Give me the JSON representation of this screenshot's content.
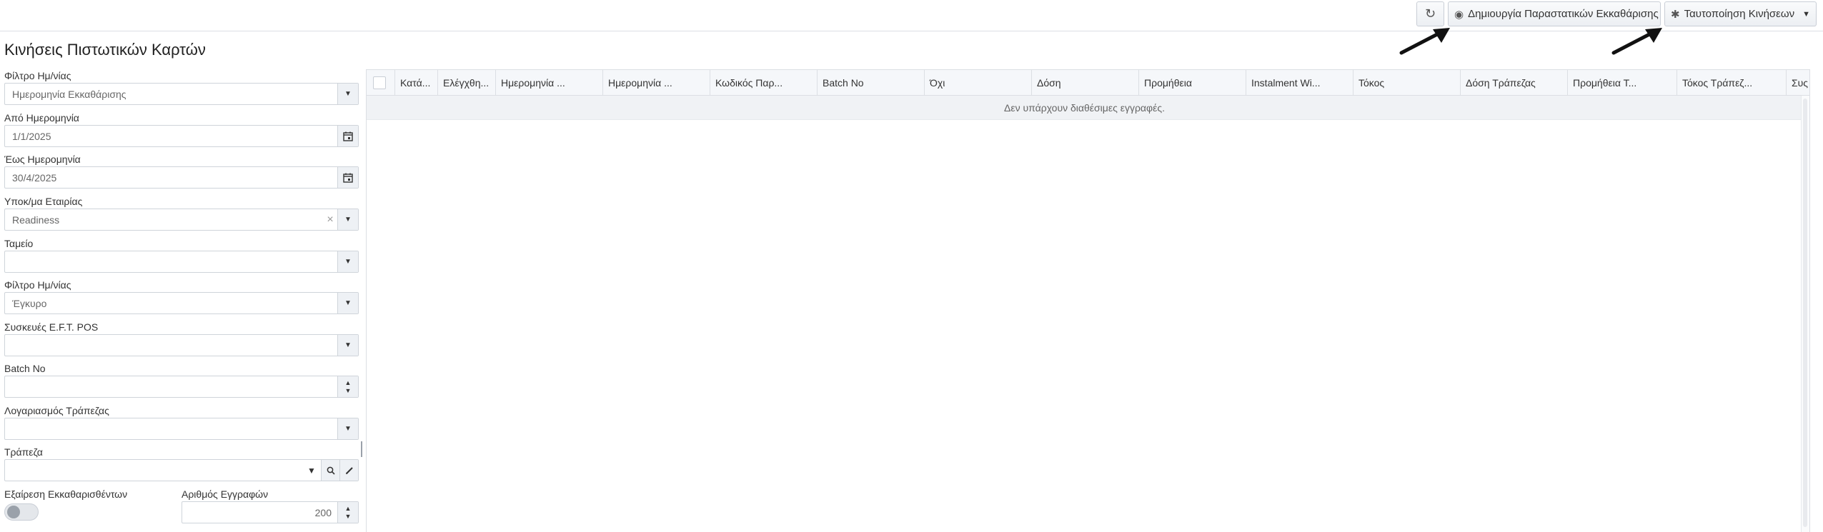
{
  "toolbar": {
    "refresh_icon": "refresh-icon",
    "create_label": "Δημιουργία Παραστατικών Εκκαθάρισης",
    "match_label": "Ταυτοποίηση Κινήσεων"
  },
  "page": {
    "title": "Κινήσεις Πιστωτικών Καρτών"
  },
  "form": {
    "date_filter_label": "Φίλτρο Ημ/νίας",
    "date_filter_value": "Ημερομηνία Εκκαθάρισης",
    "from_date_label": "Από Ημερομηνία",
    "from_date_value": "1/1/2025",
    "to_date_label": "Έως Ημερομηνία",
    "to_date_value": "30/4/2025",
    "branch_label": "Υποκ/μα Εταιρίας",
    "branch_value": "Readiness",
    "cashier_label": "Ταμείο",
    "cashier_value": "",
    "date_filter2_label": "Φίλτρο Ημ/νίας",
    "date_filter2_value": "Έγκυρο",
    "eft_label": "Συσκευές E.F.T. POS",
    "eft_value": "",
    "batch_label": "Batch No",
    "batch_value": "",
    "bank_account_label": "Λογαριασμός Τράπεζας",
    "bank_account_value": "",
    "bank_label": "Τράπεζα",
    "bank_value": "",
    "exclude_label": "Εξαίρεση Εκκαθαρισθέντων",
    "records_label": "Αριθμός Εγγραφών",
    "records_value": "200"
  },
  "grid": {
    "columns": [
      "Κατά...",
      "Ελέγχθη...",
      "Ημερομηνία ...",
      "Ημερομηνία ...",
      "Κωδικός Παρ...",
      "Batch No",
      "Όχι",
      "Δόση",
      "Προμήθεια",
      "Instalment Wi...",
      "Τόκος",
      "Δόση Τράπεζας",
      "Προμήθεια Τ...",
      "Τόκος Τράπεζ...",
      "Συς"
    ],
    "empty_message": "Δεν υπάρχουν διαθέσιμες εγγραφές."
  }
}
